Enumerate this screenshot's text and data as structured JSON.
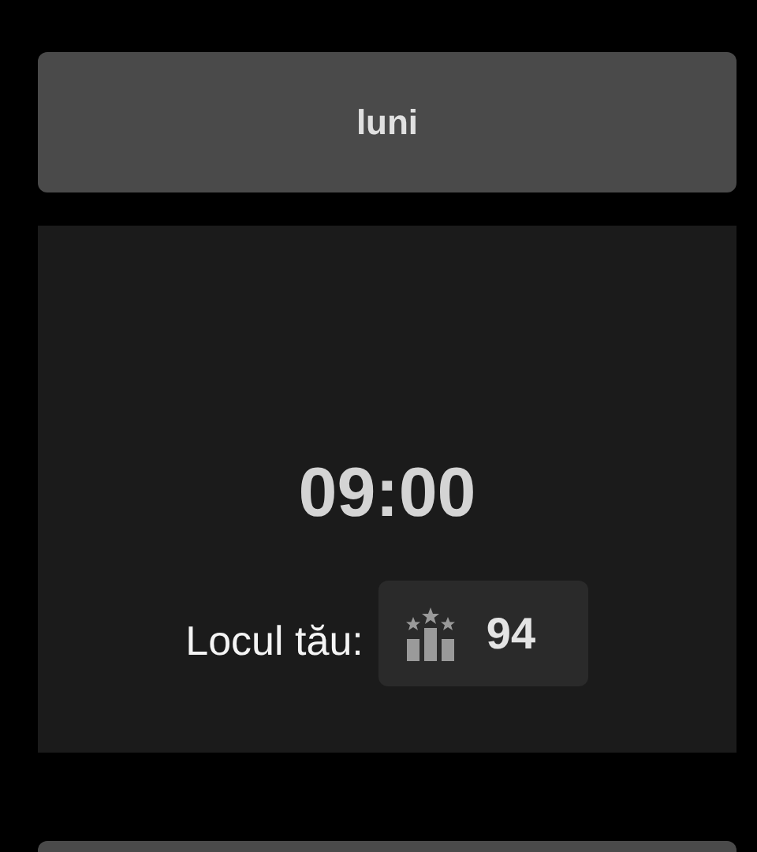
{
  "day": {
    "label": "luni"
  },
  "session": {
    "time": "09:00",
    "rank_label": "Locul tău:",
    "rank": "94"
  }
}
